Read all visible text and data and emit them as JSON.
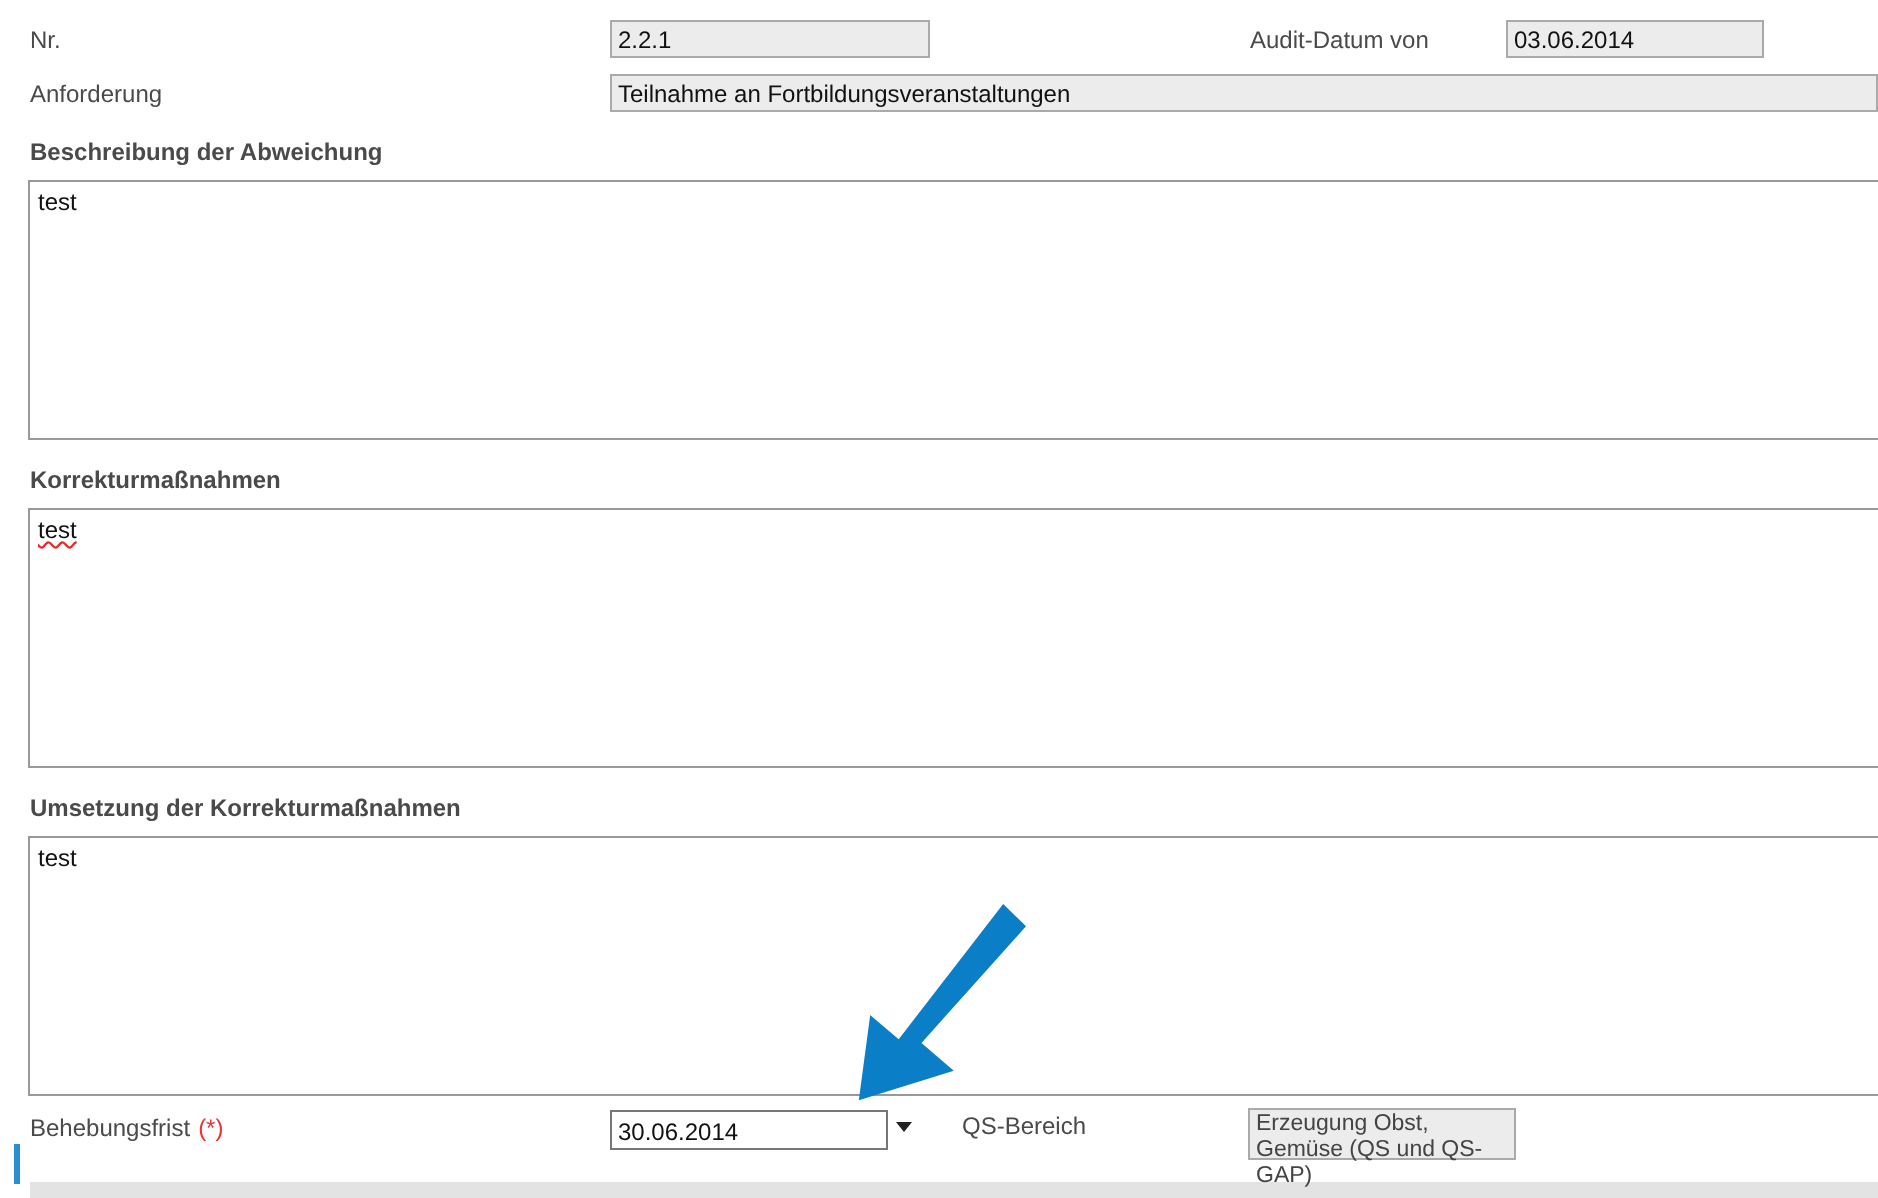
{
  "header_fields": {
    "number": {
      "label": "Nr.",
      "value": "2.2.1"
    },
    "audit_date": {
      "label": "Audit-Datum von",
      "value": "03.06.2014"
    },
    "requirement": {
      "label": "Anforderung",
      "value": "Teilnahme an Fortbildungsveranstaltungen"
    }
  },
  "sections": [
    {
      "heading": "Beschreibung der Abweichung",
      "value": "test",
      "spelling_error": false
    },
    {
      "heading": "Korrekturmaßnahmen",
      "value": "test",
      "spelling_error": true
    },
    {
      "heading": "Umsetzung der Korrekturmaßnahmen",
      "value": "test",
      "spelling_error": false
    }
  ],
  "deadline": {
    "label": "Behebungsfrist",
    "required_mark": "(*)",
    "value": "30.06.2014"
  },
  "qs_area": {
    "label": "QS-Bereich",
    "value": "Erzeugung Obst, Gemüse (QS und QS-GAP)"
  }
}
